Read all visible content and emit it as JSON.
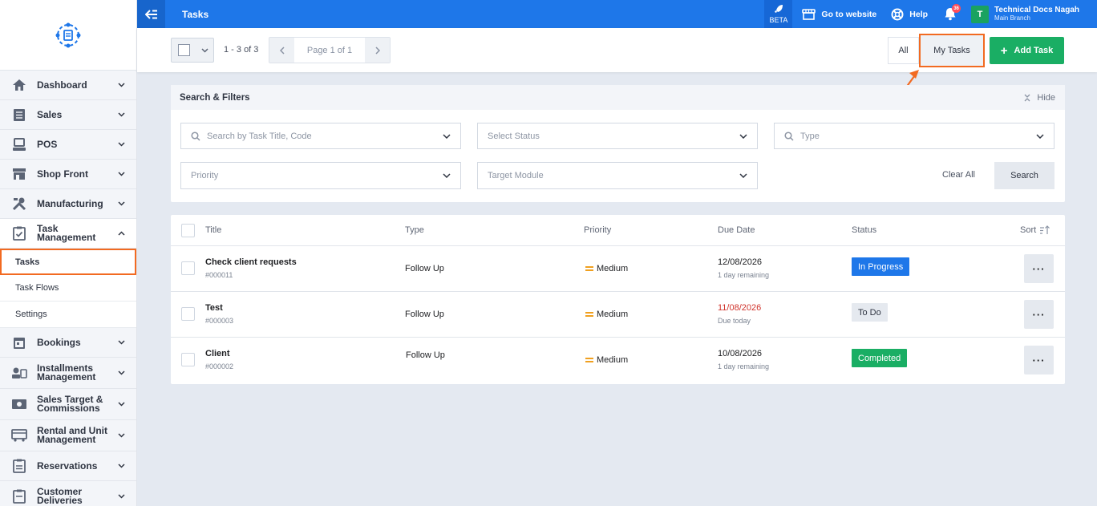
{
  "topbar": {
    "title": "Tasks",
    "beta_label": "BETA",
    "go_to_website": "Go to website",
    "help": "Help",
    "notification_count": "36",
    "user_initial": "T",
    "user_name": "Technical Docs Nagah",
    "user_branch": "Main Branch"
  },
  "sidebar": {
    "items": [
      {
        "label": "Dashboard",
        "icon": "home-icon"
      },
      {
        "label": "Sales",
        "icon": "sales-icon"
      },
      {
        "label": "POS",
        "icon": "pos-icon"
      },
      {
        "label": "Shop Front",
        "icon": "shop-icon"
      },
      {
        "label": "Manufacturing",
        "icon": "tools-icon"
      },
      {
        "label": "Task Management",
        "icon": "clipboard-check-icon"
      },
      {
        "label": "Bookings",
        "icon": "calendar-icon"
      },
      {
        "label": "Installments Management",
        "icon": "installments-icon"
      },
      {
        "label": "Sales Target & Commissions",
        "icon": "money-icon"
      },
      {
        "label": "Rental and Unit Management",
        "icon": "rental-icon"
      },
      {
        "label": "Reservations",
        "icon": "reservations-icon"
      },
      {
        "label": "Customer Deliveries",
        "icon": "deliveries-icon"
      }
    ],
    "sub_items": [
      {
        "label": "Tasks"
      },
      {
        "label": "Task Flows"
      },
      {
        "label": "Settings"
      }
    ]
  },
  "toolbar": {
    "count": "1 - 3 of 3",
    "page": "Page 1 of 1",
    "all_label": "All",
    "my_tasks_label": "My Tasks",
    "add_task_label": "Add Task"
  },
  "filters": {
    "title": "Search & Filters",
    "hide_label": "Hide",
    "search_placeholder": "Search by Task Title, Code",
    "status_placeholder": "Select Status",
    "type_placeholder": "Type",
    "priority_placeholder": "Priority",
    "module_placeholder": "Target Module",
    "clear_all": "Clear All",
    "search_button": "Search"
  },
  "table": {
    "headers": {
      "title": "Title",
      "type": "Type",
      "priority": "Priority",
      "due_date": "Due Date",
      "status": "Status",
      "sort": "Sort"
    },
    "rows": [
      {
        "title": "Check client requests",
        "code": "#000011",
        "type": "Follow Up",
        "priority": "Medium",
        "due_date": "12/08/2026",
        "remaining": "1 day remaining",
        "status": "In Progress"
      },
      {
        "title": "Test",
        "code": "#000003",
        "type": "Follow Up",
        "priority": "Medium",
        "due_date": "11/08/2026",
        "remaining": "Due today",
        "status": "To Do"
      },
      {
        "title": "Client",
        "code": "#000002",
        "type": "Follow Up",
        "priority": "Medium",
        "due_date": "10/08/2026",
        "remaining": "1 day remaining",
        "status": "Completed"
      }
    ]
  },
  "colors": {
    "primary": "#1e77e9",
    "success": "#1aae64",
    "highlight": "#f26a21",
    "overdue": "#d0342c"
  }
}
